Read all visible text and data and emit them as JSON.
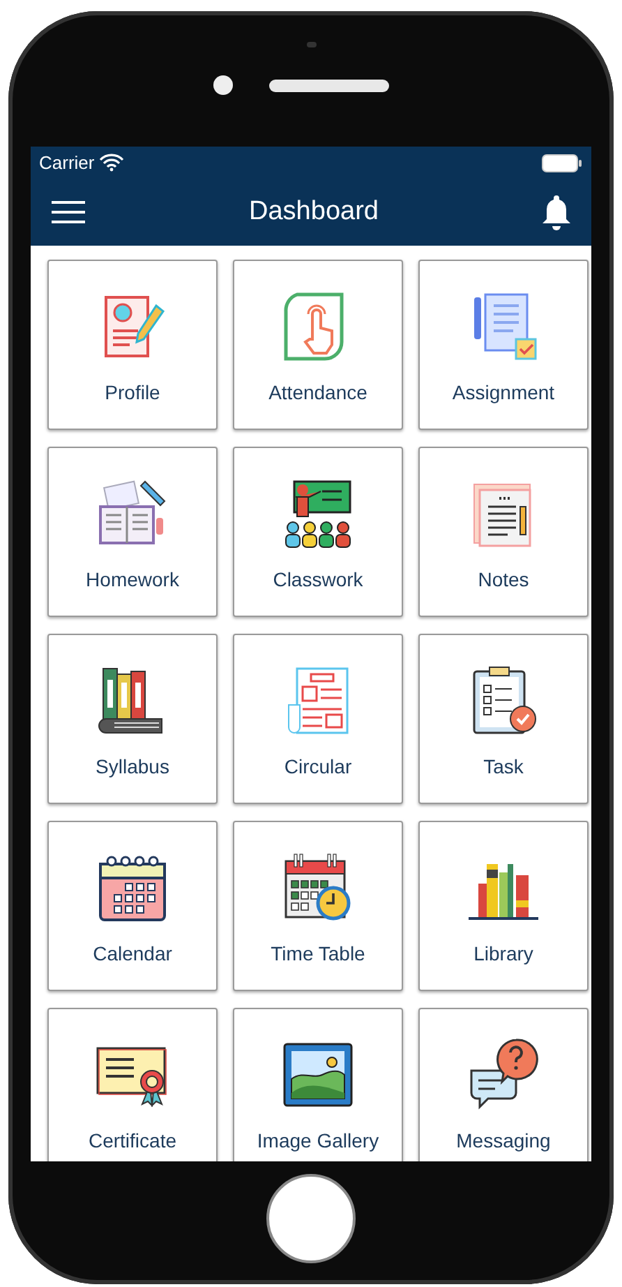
{
  "status_bar": {
    "carrier": "Carrier"
  },
  "header": {
    "title": "Dashboard"
  },
  "tiles": [
    {
      "kind": "profile",
      "label": "Profile"
    },
    {
      "kind": "attendance",
      "label": "Attendance"
    },
    {
      "kind": "assignment",
      "label": "Assignment"
    },
    {
      "kind": "homework",
      "label": "Homework"
    },
    {
      "kind": "classwork",
      "label": "Classwork"
    },
    {
      "kind": "notes",
      "label": "Notes"
    },
    {
      "kind": "syllabus",
      "label": "Syllabus"
    },
    {
      "kind": "circular",
      "label": "Circular"
    },
    {
      "kind": "task",
      "label": "Task"
    },
    {
      "kind": "calendar",
      "label": "Calendar"
    },
    {
      "kind": "timetable",
      "label": "Time Table"
    },
    {
      "kind": "library",
      "label": "Library"
    },
    {
      "kind": "certificate",
      "label": "Certificate"
    },
    {
      "kind": "gallery",
      "label": "Image Gallery"
    },
    {
      "kind": "messaging",
      "label": "Messaging"
    }
  ]
}
